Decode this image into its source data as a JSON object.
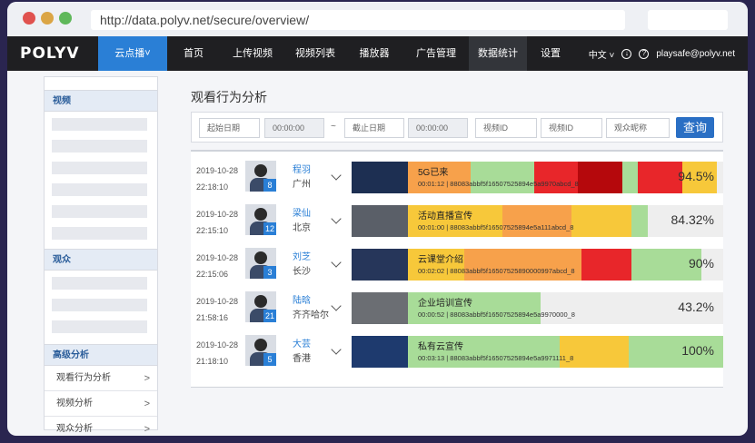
{
  "browser": {
    "url": "http://data.polyv.net/secure/overview/"
  },
  "nav": {
    "logo": "POLYV",
    "items": [
      {
        "label": "云点播˅",
        "width": 76,
        "style": "active-blue"
      },
      {
        "label": "首页",
        "width": 58,
        "style": ""
      },
      {
        "label": "上传视频",
        "width": 72,
        "style": ""
      },
      {
        "label": "视频列表",
        "width": 66,
        "style": ""
      },
      {
        "label": "播放器",
        "width": 64,
        "style": ""
      },
      {
        "label": "广告管理",
        "width": 72,
        "style": ""
      },
      {
        "label": "数据统计",
        "width": 64,
        "style": "active-dark"
      },
      {
        "label": "设置",
        "width": 52,
        "style": ""
      }
    ],
    "lang": "中文 ˅",
    "user": "playsafe@polyv.net"
  },
  "sidebar": {
    "section_video": "视频",
    "section_audience": "观众",
    "section_advanced": "高级分析",
    "links": [
      "观看行为分析",
      "视频分析",
      "观众分析"
    ]
  },
  "main": {
    "title": "观看行为分析",
    "filter": {
      "start_date": "起始日期",
      "start_time": "00:00:00",
      "tilde": "~",
      "end_date": "截止日期",
      "end_time": "00:00:00",
      "video_id_1": "视频ID",
      "video_id_2": "视频ID",
      "viewer_nick": "观众昵称",
      "query": "查询"
    },
    "rows": [
      {
        "date": "2019-10-28",
        "time": "22:18:10",
        "badge": "8",
        "name": "程羽",
        "city": "广州",
        "video_title": "5G已来",
        "meta": "00:01:12 | 88083abbf5f16507525894e5a9970abcd_8",
        "percent": "94.5%",
        "segments": [
          [
            "#f7a14b",
            0.2
          ],
          [
            "#a8dc98",
            0.2
          ],
          [
            "#e8262a",
            0.14
          ],
          [
            "#b5080c",
            0.14
          ],
          [
            "#a8dc98",
            0.05
          ],
          [
            "#e8262a",
            0.14
          ],
          [
            "#f7c83a",
            0.11
          ],
          [
            "#eeeeee",
            0.02
          ]
        ]
      },
      {
        "date": "2019-10-28",
        "time": "22:15:10",
        "badge": "12",
        "name": "梁仙",
        "city": "北京",
        "video_title": "活动直播宣传",
        "meta": "00:01:00 | 88083abbf5f16507525894e5a111abcd_8",
        "percent": "84.32%",
        "segments": [
          [
            "#f7c83a",
            0.3
          ],
          [
            "#f7a14b",
            0.22
          ],
          [
            "#f7c83a",
            0.19
          ],
          [
            "#a8dc98",
            0.05
          ],
          [
            "#eeeeee",
            0.24
          ]
        ]
      },
      {
        "date": "2019-10-28",
        "time": "22:15:06",
        "badge": "3",
        "name": "刘芝",
        "city": "长沙",
        "video_title": "云课堂介绍",
        "meta": "00:02:02 | 88083abbf5f16507525890000997abcd_8",
        "percent": "90%",
        "segments": [
          [
            "#f7c83a",
            0.18
          ],
          [
            "#f7a14b",
            0.37
          ],
          [
            "#e8262a",
            0.16
          ],
          [
            "#a8dc98",
            0.22
          ],
          [
            "#eeeeee",
            0.07
          ]
        ]
      },
      {
        "date": "2019-10-28",
        "time": "21:58:16",
        "badge": "21",
        "name": "陆晗",
        "city": "齐齐哈尔",
        "video_title": "企业培训宣传",
        "meta": "00:00:52 | 88083abbf5f16507525894e5a9970000_8",
        "percent": "43.2%",
        "segments": [
          [
            "#a8dc98",
            0.42
          ],
          [
            "#eeeeee",
            0.58
          ]
        ]
      },
      {
        "date": "2019-10-28",
        "time": "21:18:10",
        "badge": "5",
        "name": "大芸",
        "city": "香港",
        "video_title": "私有云宣传",
        "meta": "00:03:13 | 88083abbf5f16507525894e5a9971111_8",
        "percent": "100%",
        "segments": [
          [
            "#a8dc98",
            0.48
          ],
          [
            "#f7c83a",
            0.22
          ],
          [
            "#a8dc98",
            0.3
          ]
        ]
      }
    ]
  }
}
